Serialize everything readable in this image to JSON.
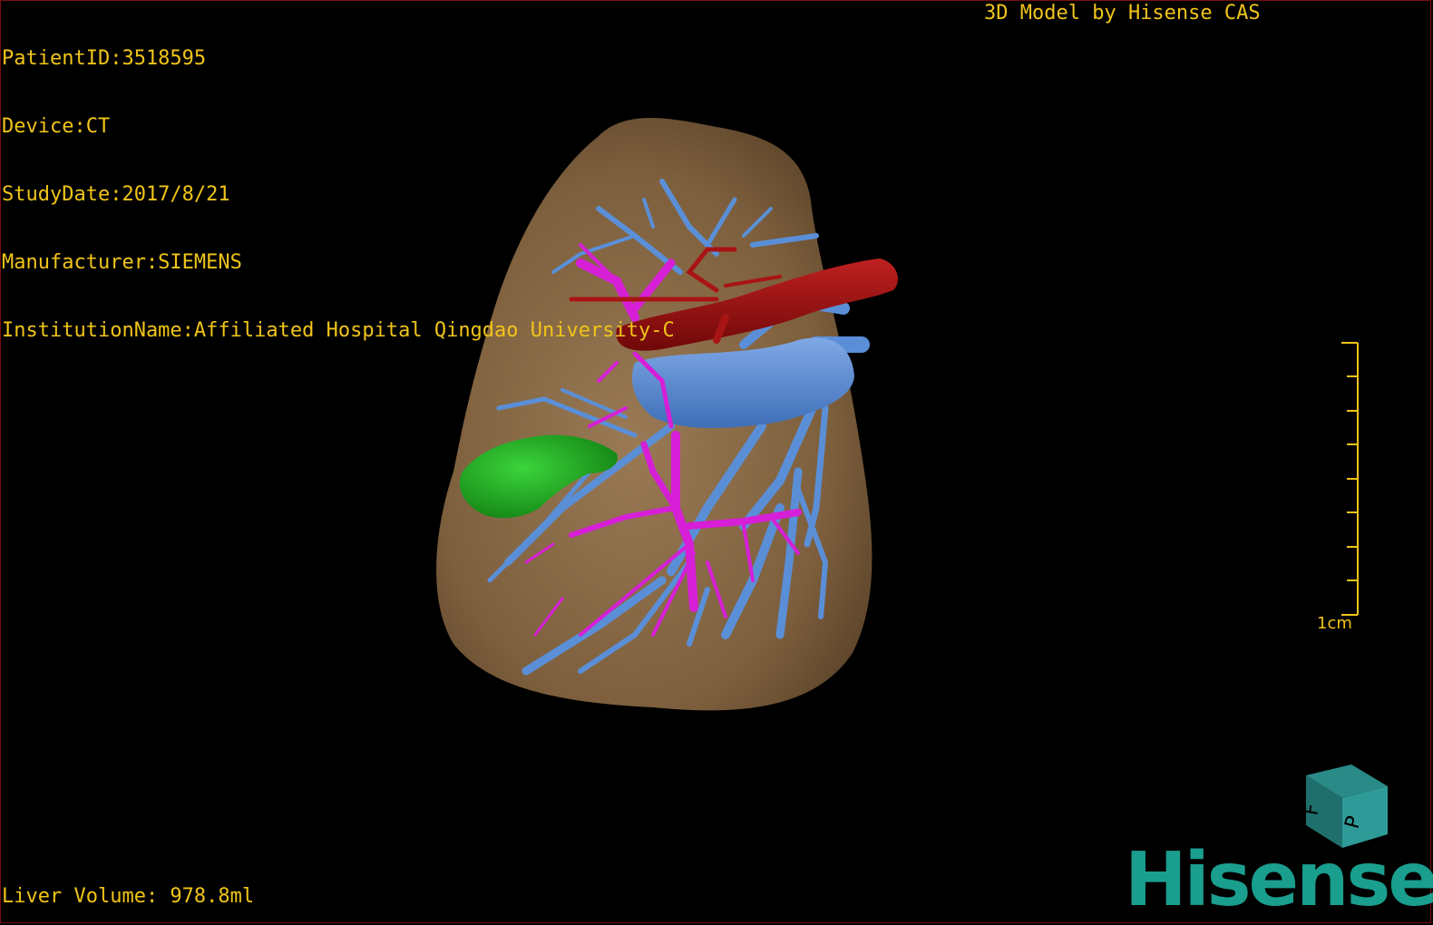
{
  "overlay": {
    "patient_id": "PatientID:3518595",
    "device": "Device:CT",
    "study_date": "StudyDate:2017/8/21",
    "manufacturer": "Manufacturer:SIEMENS",
    "institution": "InstitutionName:Affiliated Hospital Qingdao University-C",
    "model_credit": "3D Model by Hisense CAS",
    "liver_volume": "Liver Volume: 978.8ml"
  },
  "scale_bar": {
    "label": "1cm"
  },
  "orientation_cube": {
    "icon": "orientation-cube-icon",
    "faces": [
      "F",
      "P"
    ]
  },
  "logo": {
    "text": "Hisense"
  },
  "colors": {
    "overlay_text": "#f0c419",
    "liver": "#8a6a45",
    "portal_vein": "#5a8fd8",
    "hepatic_vein": "#d61fd6",
    "artery": "#9b1010",
    "gallbladder": "#1fa51f",
    "logo": "#1a9e8e"
  }
}
